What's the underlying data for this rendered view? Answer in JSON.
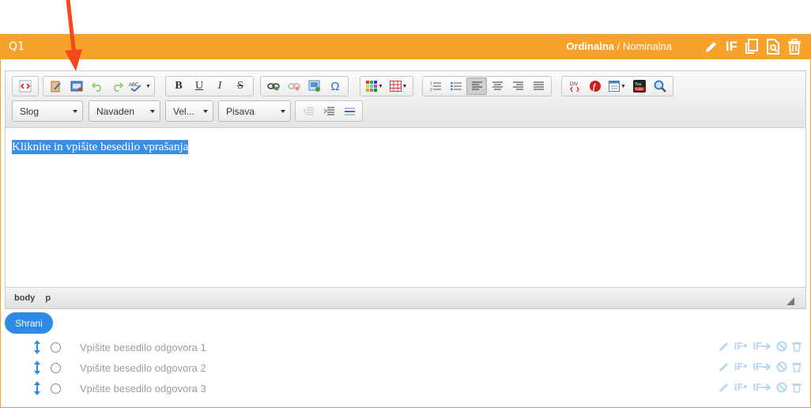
{
  "question": {
    "number": "Q1",
    "type_active": "Ordinalna",
    "type_separator": " / ",
    "type_inactive": "Nominalna",
    "if_label": "IF"
  },
  "toolbar": {
    "style_combo": "Slog",
    "format_combo": "Navaden",
    "size_combo": "Vel...",
    "font_combo": "Pisava",
    "bold": "B",
    "underline": "U",
    "italic": "I",
    "strike": "S",
    "omega": "Ω"
  },
  "editor": {
    "content": "Kliknite in vpišite besedilo vprašanja",
    "path": [
      "body",
      "p"
    ]
  },
  "save_button": "Shrani",
  "answers": [
    {
      "label": "Vpišite besedilo odgovora 1"
    },
    {
      "label": "Vpišite besedilo odgovora 2"
    },
    {
      "label": "Vpišite besedilo odgovora 3"
    }
  ],
  "answer_tools": {
    "if_label": "IF",
    "if_goto_label": "IF"
  },
  "colors": {
    "accent": "#f9a22b",
    "primary": "#2d8ae6",
    "selection": "#3a8ee6",
    "arrow": "#f4471a"
  }
}
